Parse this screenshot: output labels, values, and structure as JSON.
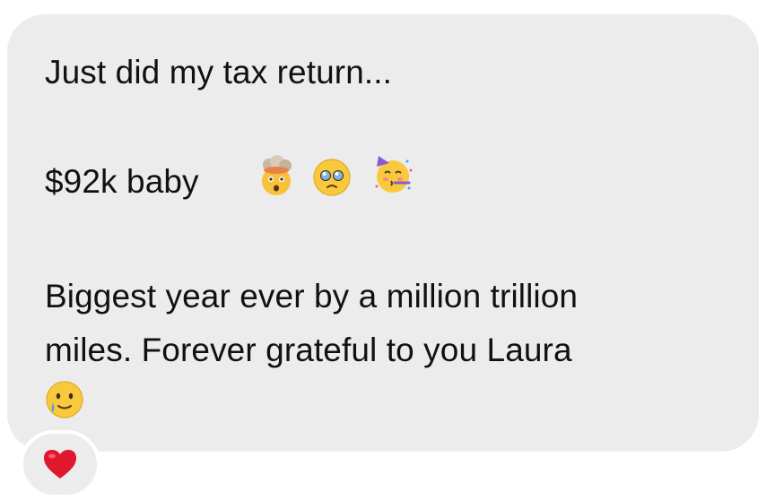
{
  "message": {
    "line1": "Just did my tax return...",
    "line2": "$92k baby",
    "line3": "Biggest year ever by a million trillion",
    "line4": "miles. Forever grateful to you Laura",
    "emojis": [
      "exploding-head-icon",
      "pleading-face-icon",
      "partying-face-icon",
      "smiling-face-with-tear-icon"
    ]
  },
  "reaction": {
    "icon": "red-heart-icon",
    "color": "#e0182d"
  },
  "colors": {
    "bubble": "#ececed",
    "text": "#111111"
  }
}
